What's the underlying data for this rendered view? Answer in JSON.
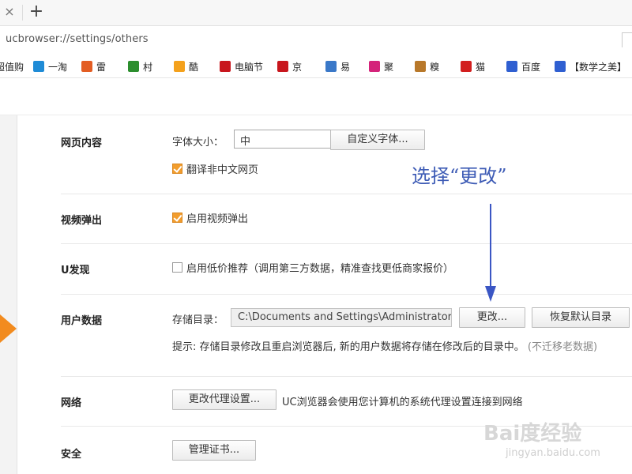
{
  "browser": {
    "tab_close_glyph": "×",
    "new_tab_glyph": "+",
    "address": "ucbrowser://settings/others"
  },
  "bookmarks": [
    {
      "label": "超值购",
      "icon": "shopping-icon",
      "color": "#e7452b"
    },
    {
      "label": "一淘",
      "icon": "yitao-icon",
      "color": "#1f8bd6"
    },
    {
      "label": "雷",
      "icon": "lei-icon",
      "color": "#e35d23"
    },
    {
      "label": "村",
      "icon": "village-icon",
      "color": "#2c8e2e"
    },
    {
      "label": "酷",
      "icon": "windows-icon",
      "color": "#f4a11c"
    },
    {
      "label": "电脑节",
      "icon": "jd-icon",
      "color": "#c8161d"
    },
    {
      "label": "京",
      "icon": "jd-icon",
      "color": "#c8161d"
    },
    {
      "label": "易",
      "icon": "yi-icon",
      "color": "#3a78c8"
    },
    {
      "label": "聚",
      "icon": "ju-icon",
      "color": "#d4237a"
    },
    {
      "label": "糗",
      "icon": "poop-icon",
      "color": "#b8782a"
    },
    {
      "label": "猫",
      "icon": "tmall-icon",
      "color": "#d21e1e"
    },
    {
      "label": "百度",
      "icon": "baidu-paw-icon",
      "color": "#2f5fd1"
    },
    {
      "label": "【数学之美】",
      "icon": "baidu-paw-icon",
      "color": "#2f5fd1"
    }
  ],
  "sections": {
    "web_content": {
      "title": "网页内容",
      "font_size_label": "字体大小：",
      "font_size_value": "中",
      "custom_font_button": "自定义字体...",
      "translate_label": "翻译非中文网页",
      "translate_checked": true
    },
    "video_popup": {
      "title": "视频弹出",
      "enable_label": "启用视频弹出",
      "enable_checked": true
    },
    "u_discover": {
      "title": "U发现",
      "low_price_label": "启用低价推荐（调用第三方数据，精准查找更低商家报价）",
      "low_price_checked": false
    },
    "user_data": {
      "title": "用户数据",
      "storage_label": "存储目录：",
      "storage_path": "C:\\Documents and Settings\\Administrator\\Local",
      "change_button": "更改...",
      "restore_button": "恢复默认目录",
      "hint": "提示: 存储目录修改且重启浏览器后, 新的用户数据将存储在修改后的目录中。",
      "hint_muted": "(不迁移老数据)"
    },
    "network": {
      "title": "网络",
      "proxy_button": "更改代理设置...",
      "proxy_desc": "UC浏览器会使用您计算机的系统代理设置连接到网络"
    },
    "security": {
      "title": "安全",
      "cert_button": "管理证书..."
    }
  },
  "annotation": {
    "text": "选择“更改”",
    "color": "#3b56c4"
  },
  "watermark": {
    "main": "Bai度经验",
    "sub": "jingyan.baidu.com"
  }
}
